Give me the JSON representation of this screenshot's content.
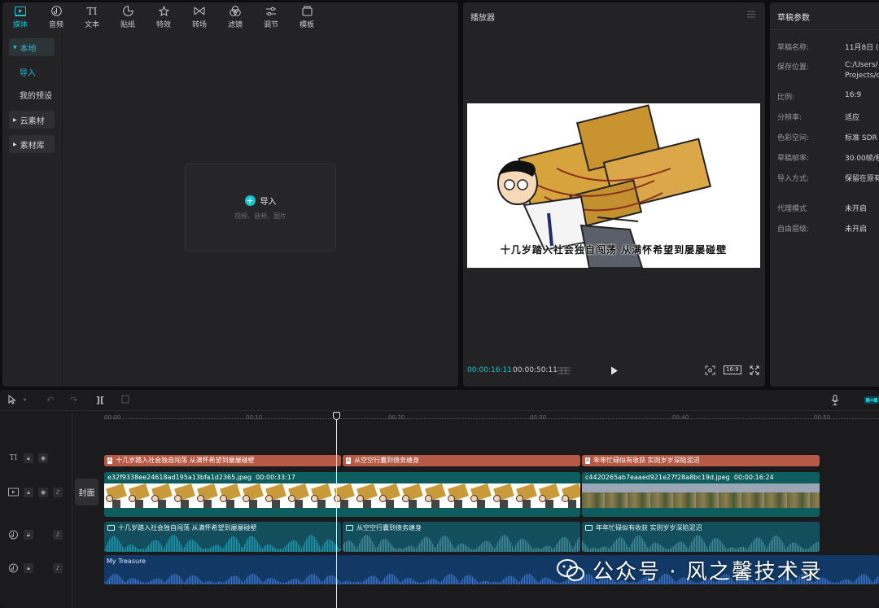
{
  "toolbar": {
    "items": [
      {
        "label": "媒体",
        "icon": "media-icon"
      },
      {
        "label": "音频",
        "icon": "audio-icon"
      },
      {
        "label": "文本",
        "icon": "text-icon"
      },
      {
        "label": "贴纸",
        "icon": "sticker-icon"
      },
      {
        "label": "特效",
        "icon": "effects-icon"
      },
      {
        "label": "转场",
        "icon": "transition-icon"
      },
      {
        "label": "滤镜",
        "icon": "filter-icon"
      },
      {
        "label": "调节",
        "icon": "adjust-icon"
      },
      {
        "label": "模板",
        "icon": "template-icon"
      }
    ]
  },
  "leftnav": {
    "local": "本地",
    "import": "导入",
    "presets": "我的预设",
    "cloud": "云素材",
    "library": "素材库"
  },
  "dropzone": {
    "label": "导入",
    "hint": "视频、音频、图片"
  },
  "player": {
    "title": "播放器",
    "subtitle": "十几岁踏入社会独自闯荡 从满怀希望到屡屡碰壁",
    "current_time": "00:00:16:11",
    "total_time": "00:00:50:11",
    "ratio_label": "16:9"
  },
  "props": {
    "title": "草稿参数",
    "rows": [
      {
        "label": "草稿名称:",
        "value": "11月8日 ("
      },
      {
        "label": "保存位置:",
        "value": "C:/Users/",
        "value2": "Projects/c"
      },
      {
        "label": "比例:",
        "value": "16:9"
      },
      {
        "label": "分辨率:",
        "value": "适应"
      },
      {
        "label": "色彩空间:",
        "value": "标准 SDR"
      },
      {
        "label": "草稿帧率:",
        "value": "30.00帧/秒"
      },
      {
        "label": "导入方式:",
        "value": "保留在原有"
      },
      {
        "label": "代理模式",
        "value": "未开启"
      },
      {
        "label": "自由层级:",
        "value": "未开启"
      }
    ]
  },
  "timeline": {
    "ruler": [
      "00:00",
      "00:10",
      "00:20",
      "00:30",
      "00:40",
      "00:50"
    ],
    "cover_label": "封面",
    "text_clips": [
      "十几岁踏入社会独自闯荡 从满怀希望到屡屡碰壁",
      "从空空行囊到债务缠身",
      "年年忙碌似有收获 实则岁岁深陷泥沼"
    ],
    "video_clips": [
      {
        "name": "e32f9338ee24618ad195a13bfa1d2365.jpeg",
        "duration": "00:00:33:17"
      },
      {
        "name": "c4420265ab7eaaed921e27f28a8bc19d.jpeg",
        "duration": "00:00:16:24"
      }
    ],
    "audio_clips": [
      "十几岁踏入社会独自闯荡 从满怀希望到屡屡碰壁",
      "从空空行囊到债务缠身",
      "年年忙碌似有收获 实则岁岁深陷泥沼"
    ],
    "music_clip": "My Treasure",
    "track_text_icon": "TI"
  },
  "watermark": {
    "text": "公众号 · 风之馨技术录"
  },
  "colors": {
    "accent": "#19c3d3",
    "text_clip": "#b65a45",
    "video_clip": "#0d5c5e",
    "audio_clip": "#124e5c",
    "music_clip": "#123966"
  }
}
